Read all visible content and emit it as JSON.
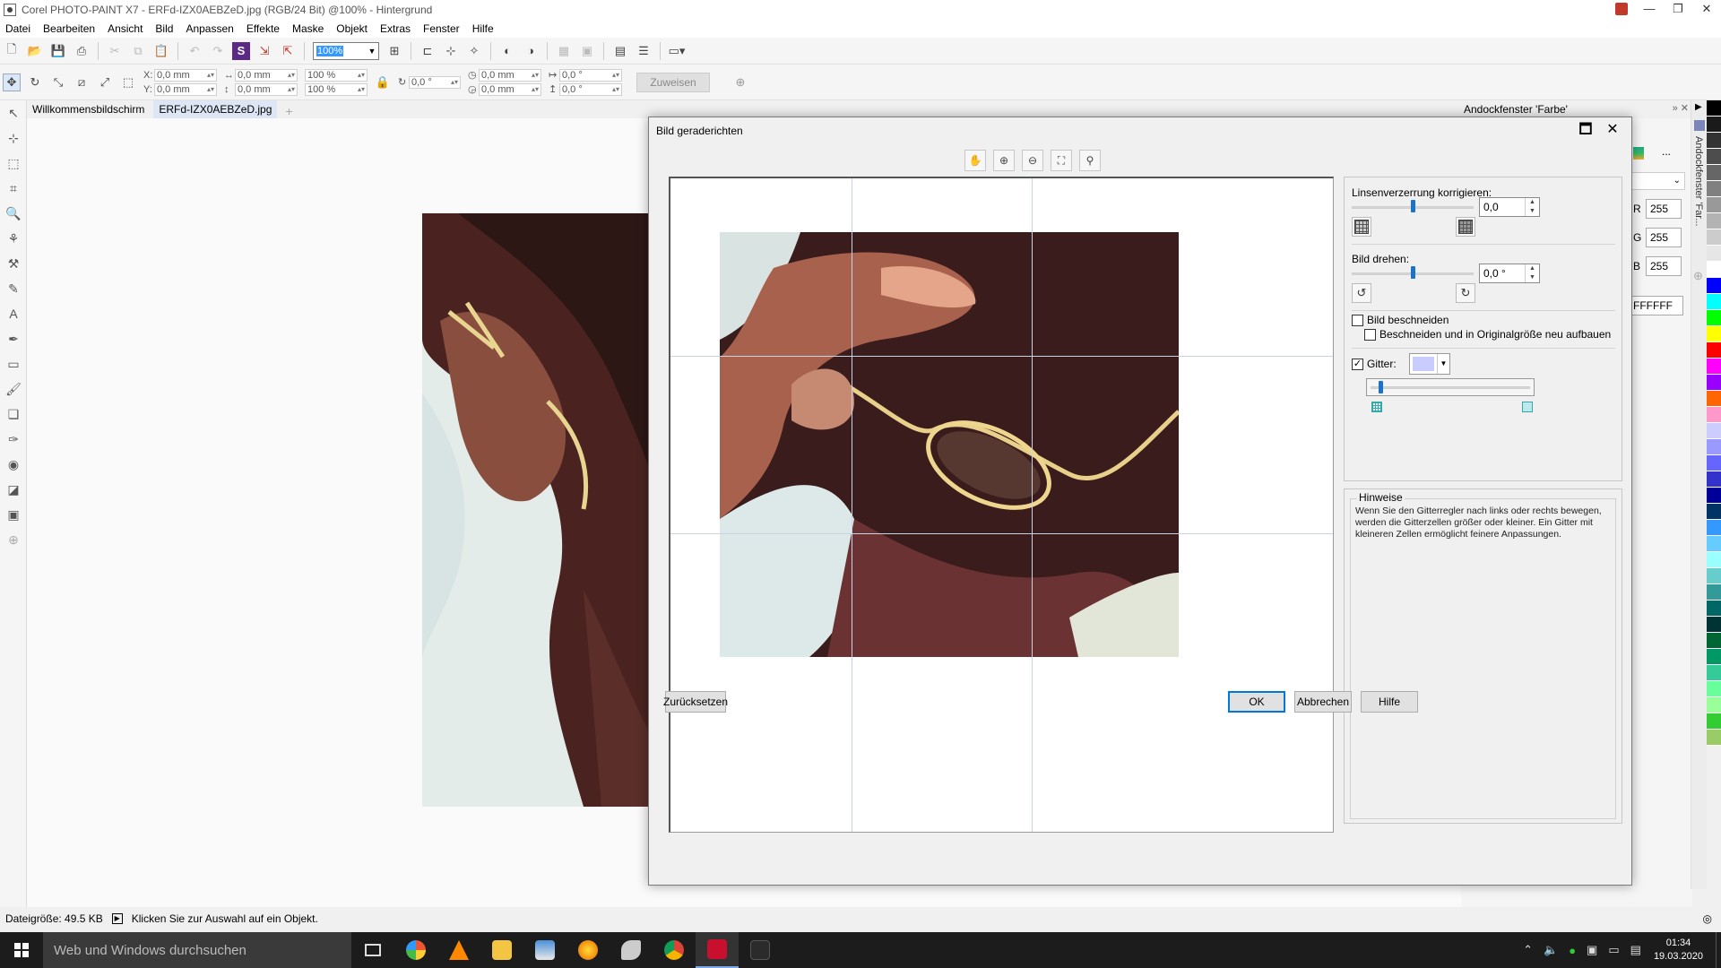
{
  "window": {
    "title": "Corel PHOTO-PAINT X7 - ERFd-IZX0AEBZeD.jpg (RGB/24 Bit) @100% - Hintergrund",
    "minimize": "—",
    "maximize": "❐",
    "close": "✕"
  },
  "menu": [
    "Datei",
    "Bearbeiten",
    "Ansicht",
    "Bild",
    "Anpassen",
    "Effekte",
    "Maske",
    "Objekt",
    "Extras",
    "Fenster",
    "Hilfe"
  ],
  "toolbar1": {
    "zoom": "100%"
  },
  "toolbar2": {
    "x_label": "X:",
    "x_value": "0,0 mm",
    "y_label": "Y:",
    "y_value": "0,0 mm",
    "w_value": "0,0 mm",
    "h_value": "0,0 mm",
    "sx_value": "100 %",
    "sy_value": "100 %",
    "rot_value": "0,0 °",
    "cx_value": "0,0 mm",
    "cy_value": "0,0 mm",
    "skew_h": "0,0 °",
    "skew_v": "0,0 °",
    "apply_label": "Zuweisen"
  },
  "tabs": [
    {
      "label": "Willkommensbildschirm"
    },
    {
      "label": "ERFd-IZX0AEBZeD.jpg"
    }
  ],
  "docker": {
    "title": "Andockfenster 'Farbe'",
    "vertical_title": "Andockfenster 'Far...",
    "more": "...",
    "r_label": "R",
    "r_value": "255",
    "g_label": "G",
    "g_value": "255",
    "b_label": "B",
    "b_value": "255",
    "hex_value": "FFFFFF"
  },
  "palette": [
    "#000000",
    "#1a1a1a",
    "#333333",
    "#4d4d4d",
    "#666666",
    "#808080",
    "#999999",
    "#b3b3b3",
    "#cccccc",
    "#e6e6e6",
    "#ffffff",
    "#0000ff",
    "#00ffff",
    "#00ff00",
    "#ffff00",
    "#ff0000",
    "#ff00ff",
    "#9900ff",
    "#ff6600",
    "#ff99cc",
    "#ccccff",
    "#9999ff",
    "#6666ff",
    "#3333cc",
    "#000099",
    "#003366",
    "#3399ff",
    "#66ccff",
    "#99ffff",
    "#66cccc",
    "#339999",
    "#006666",
    "#003333",
    "#006633",
    "#009966",
    "#33cc99",
    "#66ff99",
    "#99ff99",
    "#33cc33",
    "#99cc66"
  ],
  "status": {
    "filesize": "Dateigröße: 49.5 KB",
    "hint": "Klicken Sie zur Auswahl auf ein Objekt."
  },
  "taskbar": {
    "search_placeholder": "Web und Windows durchsuchen",
    "time": "01:34",
    "date": "19.03.2020"
  },
  "dialog": {
    "title": "Bild geraderichten",
    "lens_label": "Linsenverzerrung korrigieren:",
    "lens_value": "0,0",
    "lens_fraction": 0.5,
    "rotate_label": "Bild drehen:",
    "rotate_value": "0,0 °",
    "rotate_fraction": 0.5,
    "crop_label": "Bild beschneiden",
    "crop_checked": false,
    "crop_resize_label": "Beschneiden und in Originalgröße neu aufbauen",
    "crop_resize_checked": false,
    "grid_label": "Gitter:",
    "grid_checked": true,
    "grid_color": "#c8ccff",
    "grid_size_fraction": 0.05,
    "hints_title": "Hinweise",
    "hints_text": "Wenn Sie den Gitterregler nach links oder rechts bewegen, werden die Gitterzellen größer oder kleiner. Ein Gitter mit kleineren Zellen ermöglicht feinere Anpassungen.",
    "reset_label": "Zurücksetzen",
    "ok_label": "OK",
    "cancel_label": "Abbrechen",
    "help_label": "Hilfe"
  }
}
